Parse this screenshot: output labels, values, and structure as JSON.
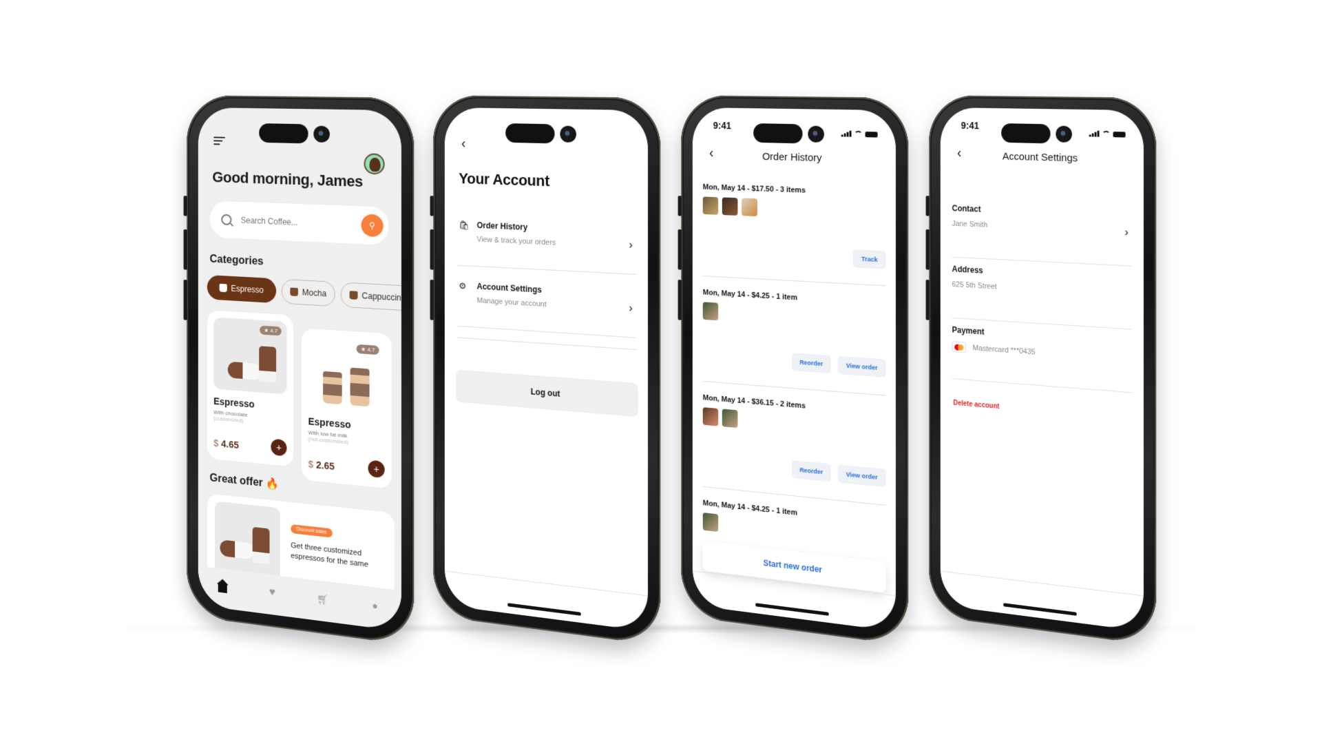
{
  "home": {
    "greeting": "Good morning, James",
    "search": {
      "placeholder": "Search Coffee..."
    },
    "categories_title": "Categories",
    "categories": [
      {
        "label": "Espresso",
        "active": true,
        "icon": "coffee-cup-icon"
      },
      {
        "label": "Mocha",
        "active": false,
        "icon": "mocha-icon"
      },
      {
        "label": "Cappuccino",
        "active": false,
        "icon": "cappuccino-icon"
      }
    ],
    "products": [
      {
        "name": "Espresso",
        "desc": "With chocolate",
        "note": "(customized)",
        "currency": "$",
        "price": "4.65",
        "rating": "4.7"
      },
      {
        "name": "Espresso",
        "desc": "With low fat milk",
        "note": "(not-customized)",
        "currency": "$",
        "price": "2.65",
        "rating": "4.7"
      }
    ],
    "offer_title": "Great offer 🔥",
    "offer": {
      "badge": "Discount sales",
      "text": "Get three customized espressos for the same"
    },
    "nav": [
      "home-icon",
      "heart-icon",
      "cart-icon",
      "profile-icon"
    ],
    "colors": {
      "accent": "#f6803a",
      "brand": "#6a3416"
    }
  },
  "account": {
    "title": "Your Account",
    "rows": [
      {
        "title": "Order History",
        "subtitle": "View & track your orders",
        "icon": "shopping-bag-icon"
      },
      {
        "title": "Account Settings",
        "subtitle": "Manage your account",
        "icon": "gear-icon"
      }
    ],
    "logout_label": "Log out"
  },
  "orders": {
    "status_time": "9:41",
    "title": "Order History",
    "list": [
      {
        "header": "Mon, May 14 - $17.50 - 3 items",
        "thumbs": 3,
        "actions": [
          "Track"
        ]
      },
      {
        "header": "Mon, May 14 - $4.25 - 1 item",
        "thumbs": 1,
        "actions": [
          "Reorder",
          "View order"
        ]
      },
      {
        "header": "Mon, May 14 - $36.15 - 2 items",
        "thumbs": 2,
        "actions": [
          "Reorder",
          "View order"
        ]
      },
      {
        "header": "Mon, May 14 - $4.25 - 1 item",
        "thumbs": 1,
        "actions": []
      }
    ],
    "start_label": "Start new order",
    "colors": {
      "link": "#2a6fd6"
    }
  },
  "settings": {
    "status_time": "9:41",
    "title": "Account Settings",
    "contact": {
      "label": "Contact",
      "value": "Jane Smith"
    },
    "address": {
      "label": "Address",
      "value": "625 5th Street"
    },
    "payment": {
      "label": "Payment",
      "value": "Mastercard ***0435"
    },
    "delete_label": "Delete account",
    "colors": {
      "danger": "#e0262a"
    }
  }
}
